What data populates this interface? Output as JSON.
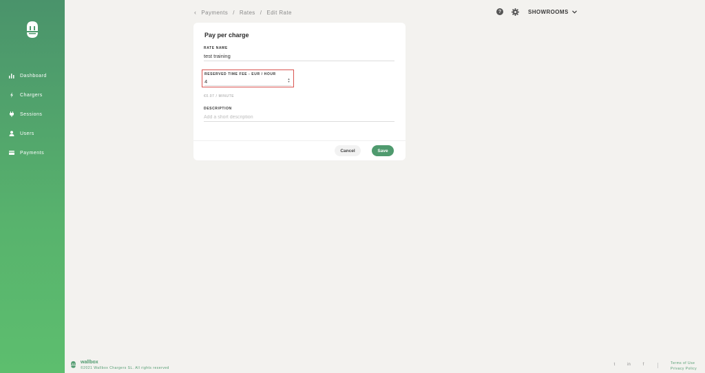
{
  "app": {
    "brand": "wallbox",
    "copyright": "©2021 Wallbox Chargers SL. All rights reserved",
    "accent_color": "#4f9a6e",
    "highlight_color": "#d9534f"
  },
  "sidebar": {
    "items": [
      {
        "label": "Dashboard",
        "icon": "bar-chart-icon"
      },
      {
        "label": "Chargers",
        "icon": "bolt-icon"
      },
      {
        "label": "Sessions",
        "icon": "plug-icon"
      },
      {
        "label": "Users",
        "icon": "user-icon"
      },
      {
        "label": "Payments",
        "icon": "card-icon"
      }
    ]
  },
  "header": {
    "breadcrumb": [
      "Payments",
      "Rates",
      "Edit Rate"
    ],
    "help_icon": "?",
    "organization": "SHOWROOMS"
  },
  "form": {
    "title": "Pay per charge",
    "rate_name_label": "RATE NAME",
    "rate_name_value": "test training",
    "fee_label": "RESERVED TIME FEE - EUR / HOUR",
    "fee_value": "4",
    "per_minute": "€0.07 / MINUTE",
    "description_label": "DESCRIPTION",
    "description_placeholder": "Add a short description",
    "cancel_label": "Cancel",
    "save_label": "Save"
  },
  "footer": {
    "socials": [
      "twitter-icon",
      "linkedin-icon",
      "facebook-icon"
    ],
    "social_glyphs": [
      "t",
      "in",
      "f"
    ],
    "terms": "Terms of Use",
    "privacy": "Privacy Policy"
  }
}
